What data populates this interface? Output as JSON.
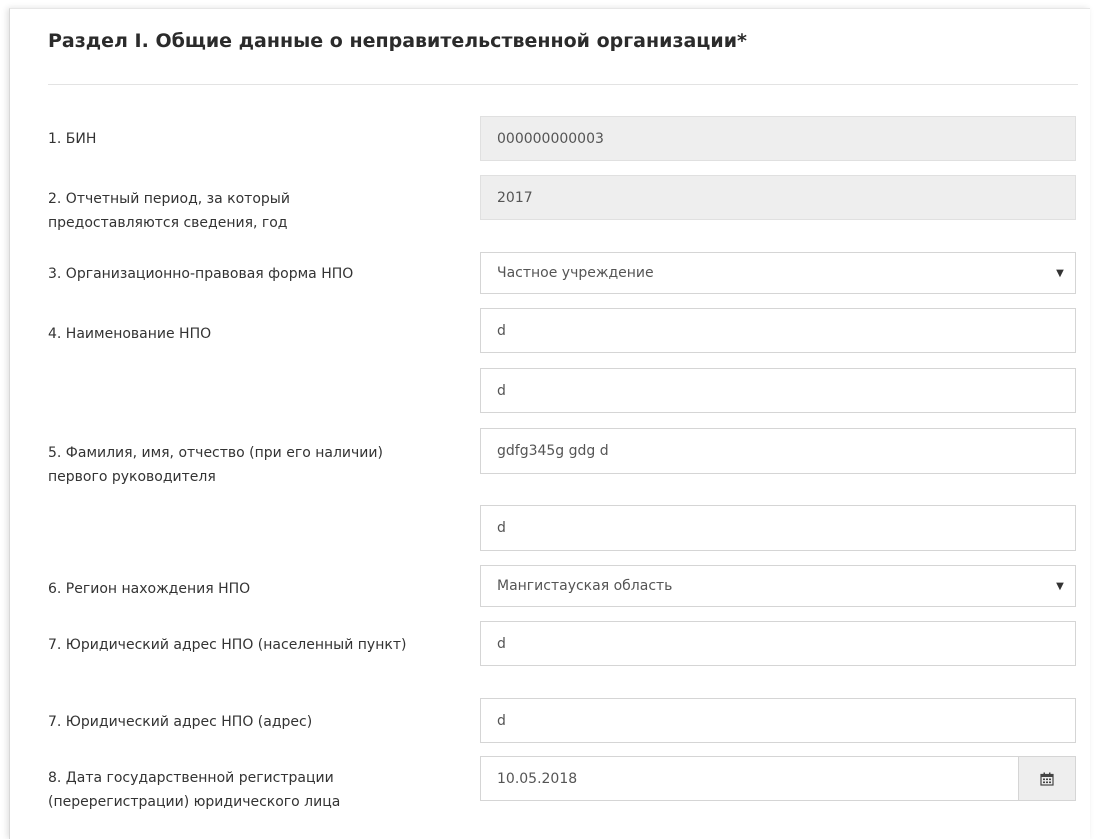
{
  "section_title": "Раздел I. Общие данные о неправительственной организации*",
  "rows": {
    "bin": {
      "label": "1. БИН",
      "value": "000000000003"
    },
    "period": {
      "label": "2. Отчетный период, за который предоставляются сведения, год",
      "value": "2017"
    },
    "legal_form": {
      "label": "3. Организационно-правовая форма НПО",
      "value": "Частное учреждение"
    },
    "name": {
      "label": "4. Наименование НПО",
      "value1": "d",
      "value2": "d"
    },
    "director": {
      "label": "5. Фамилия, имя, отчество (при его наличии) первого руководителя",
      "value1": "gdfg345g gdg d",
      "value2": "d"
    },
    "region": {
      "label": "6. Регион нахождения НПО",
      "value": "Мангистауская область"
    },
    "legal_locality": {
      "label": "7. Юридический адрес НПО (населенный пункт)",
      "value": "d"
    },
    "legal_address": {
      "label": "7. Юридический адрес НПО (адрес)",
      "value": "d"
    },
    "registration_date": {
      "label": "8. Дата государственной регистрации (перерегистрации) юридического лица",
      "value": "10.05.2018"
    }
  },
  "icons": {
    "select_caret": "caret-down-icon",
    "date_picker": "calendar-icon"
  }
}
